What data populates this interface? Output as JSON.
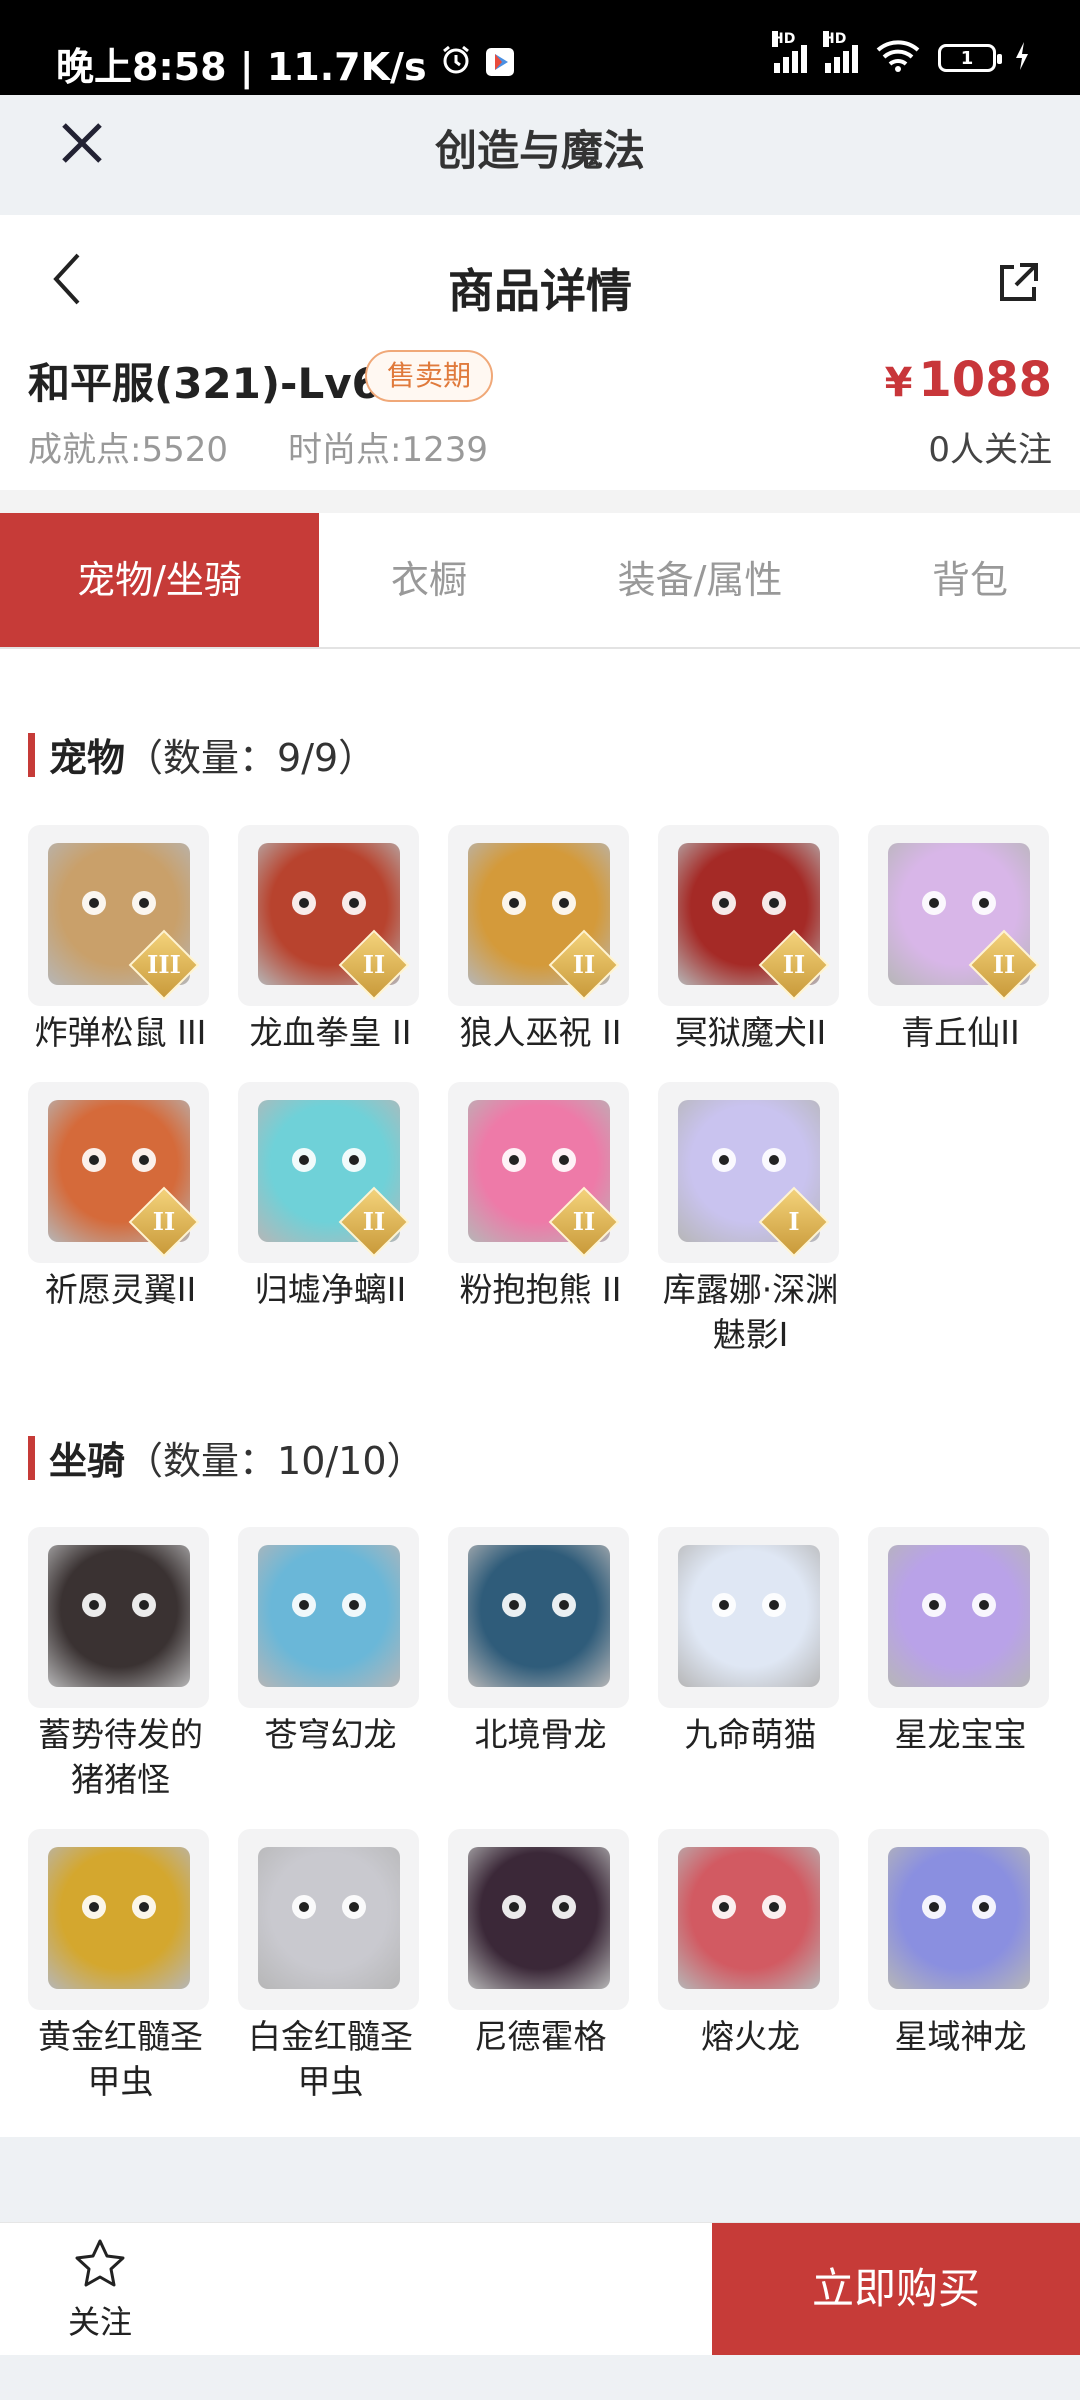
{
  "status": {
    "time": "晚上8:58 | 11.7K/s",
    "battery": "1"
  },
  "sheet": {
    "title": "创造与魔法"
  },
  "nav": {
    "title": "商品详情"
  },
  "product": {
    "name": "和平服(321)-Lv69",
    "badge": "售卖期",
    "achievement_label": "成就点:",
    "achievement_value": "5520",
    "fashion_label": "时尚点:",
    "fashion_value": "1239",
    "price_symbol": "¥",
    "price": "1088",
    "followers": "0人关注"
  },
  "tabs": [
    "宠物/坐骑",
    "衣橱",
    "装备/属性",
    "背包"
  ],
  "pets": {
    "title": "宠物",
    "count": "（数量：9/9）",
    "items": [
      {
        "label": "炸弹松鼠 III",
        "tier": "III",
        "icon": "bomb-squirrel-icon",
        "color": "#c9a06a"
      },
      {
        "label": "龙血拳皇 II",
        "tier": "II",
        "icon": "dragonblood-boxer-icon",
        "color": "#b8432e"
      },
      {
        "label": "狼人巫祝 II",
        "tier": "II",
        "icon": "werewolf-shaman-icon",
        "color": "#d49a3a"
      },
      {
        "label": "冥狱魔犬II",
        "tier": "II",
        "icon": "hellhound-icon",
        "color": "#a52a26"
      },
      {
        "label": "青丘仙II",
        "tier": "II",
        "icon": "qingqiu-fairy-icon",
        "color": "#d8b6e8"
      },
      {
        "label": "祈愿灵翼II",
        "tier": "II",
        "icon": "wish-wing-icon",
        "color": "#d56a3a"
      },
      {
        "label": "归墟净螭II",
        "tier": "II",
        "icon": "guixu-dragon-icon",
        "color": "#6fd1d8"
      },
      {
        "label": "粉抱抱熊 II",
        "tier": "II",
        "icon": "pink-hug-bear-icon",
        "color": "#ee7aa8"
      },
      {
        "label": "库露娜·深渊魅影I",
        "tier": "I",
        "icon": "kuluna-abyss-icon",
        "color": "#c9c3ef"
      }
    ]
  },
  "mounts": {
    "title": "坐骑",
    "count": "（数量：10/10）",
    "items": [
      {
        "label": "蓄势待发的猪猪怪",
        "icon": "pig-monster-icon",
        "color": "#3a3232"
      },
      {
        "label": "苍穹幻龙",
        "icon": "sky-dragon-icon",
        "color": "#6ab7d8"
      },
      {
        "label": "北境骨龙",
        "icon": "bone-dragon-icon",
        "color": "#2f5c7a"
      },
      {
        "label": "九命萌猫",
        "icon": "nine-life-cat-icon",
        "color": "#dfe7f4"
      },
      {
        "label": "星龙宝宝",
        "icon": "star-dragon-baby-icon",
        "color": "#b9a2e8"
      },
      {
        "label": "黄金红髓圣甲虫",
        "icon": "golden-scarab-icon",
        "color": "#d4a72e"
      },
      {
        "label": "白金红髓圣甲虫",
        "icon": "platinum-scarab-icon",
        "color": "#c9c9cf"
      },
      {
        "label": "尼德霍格",
        "icon": "nidhogg-icon",
        "color": "#3b2838"
      },
      {
        "label": "熔火龙",
        "icon": "magma-dragon-icon",
        "color": "#d25a62"
      },
      {
        "label": "星域神龙",
        "icon": "star-domain-dragon-icon",
        "color": "#8a8fe0"
      }
    ]
  },
  "bottom": {
    "follow_label": "关注",
    "buy_label": "立即购买"
  },
  "colors": {
    "accent": "#c63b38",
    "badge": "#e07a3c",
    "price": "#c8363a"
  }
}
